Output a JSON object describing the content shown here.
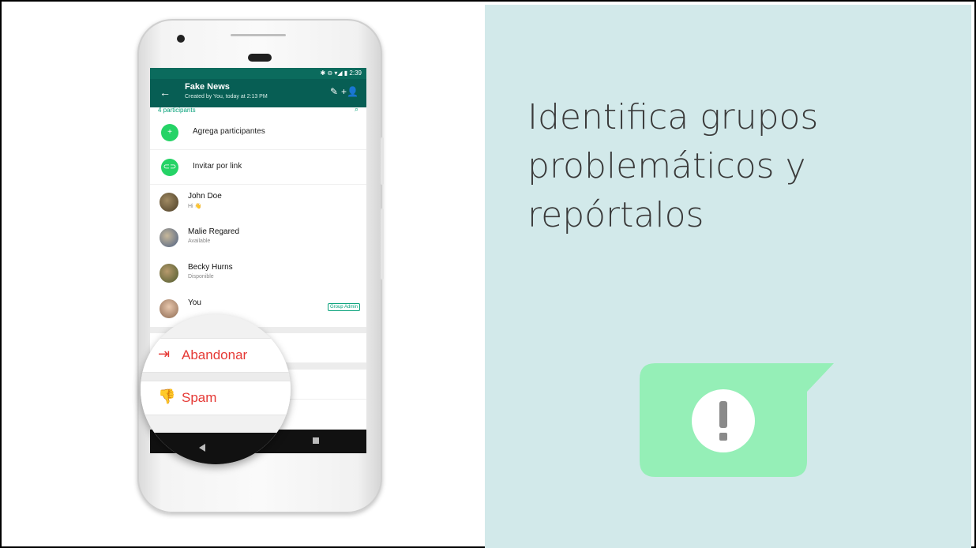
{
  "headline": "Identifica grupos problemáticos y repórtalos",
  "phone": {
    "status_time": "2:39",
    "status_icons": "✱ ⊖ ▾◢ ▮",
    "group_title": "Fake News",
    "group_subtitle": "Created by You, today at 2:13 PM",
    "participants_count": "4 participants",
    "actions": [
      {
        "label": "Agrega participantes",
        "icon": "add-person-icon"
      },
      {
        "label": "Invitar por link",
        "icon": "link-icon"
      }
    ],
    "contacts": [
      {
        "name": "John Doe",
        "status": "Hi 👋",
        "avatar_color": "#6b5a3c"
      },
      {
        "name": "Malie Regared",
        "status": "Available",
        "avatar_color": "#7c8ea8"
      },
      {
        "name": "Becky Hurns",
        "status": "Disponible",
        "avatar_color": "#6f7a45"
      },
      {
        "name": "You",
        "status": "",
        "avatar_color": "#c9a58a",
        "badge": "Group Admin"
      }
    ],
    "exit_label": "Abandonar",
    "spam_label": "Spam"
  },
  "colors": {
    "whatsapp_dark": "#075e54",
    "whatsapp_green": "#25d366",
    "danger_red": "#e53935",
    "right_panel_bg": "#d2e9ea",
    "bubble_green": "#95efb7"
  }
}
